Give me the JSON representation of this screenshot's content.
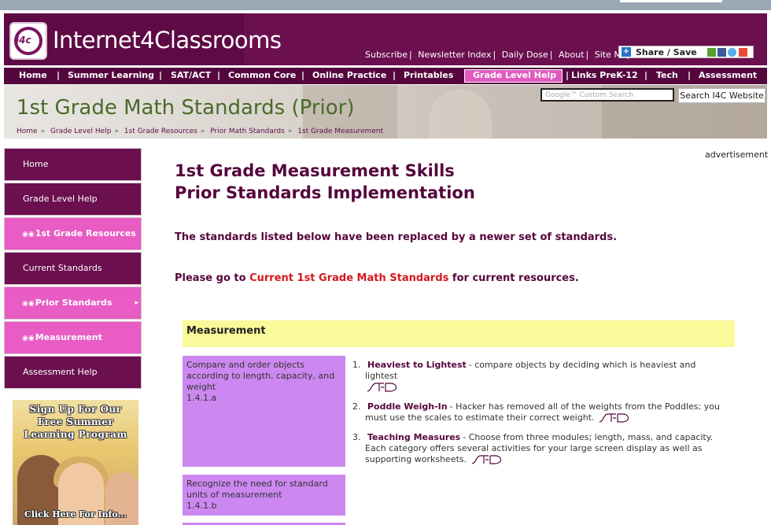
{
  "site": {
    "name": "Internet4Classrooms",
    "logo_text": "i4c"
  },
  "top_links": [
    "Subscribe",
    "Newsletter Index",
    "Daily Dose",
    "About",
    "Site Map"
  ],
  "share_label": "Share / Save",
  "nav": [
    "Home",
    "Summer Learning",
    "SAT/ACT",
    "Common Core",
    "Online Practice",
    "Printables",
    "Grade Level Help",
    "Links PreK-12",
    "Tech",
    "Assessment"
  ],
  "hero": {
    "title": "1st Grade Math Standards (Prior)",
    "search_placeholder": "Google™ Custom Search",
    "search_button": "Search I4C Website",
    "breadcrumb": [
      "Home",
      "Grade Level Help",
      "1st Grade Resources",
      "Prior Math Standards",
      "1st Grade Measurement"
    ]
  },
  "sidebar": {
    "items": [
      {
        "label": "Home",
        "style": "dark"
      },
      {
        "label": "Grade Level Help",
        "style": "dark"
      },
      {
        "label": "1st Grade Resources",
        "style": "pink"
      },
      {
        "label": "Current Standards",
        "style": "dark"
      },
      {
        "label": "Prior Standards",
        "style": "pink"
      },
      {
        "label": "Measurement",
        "style": "pink"
      },
      {
        "label": "Assessment Help",
        "style": "dark"
      }
    ],
    "promo_text": "Sign Up For Our Free Summer Learning Program",
    "promo_cta": "Click Here For Info..."
  },
  "ad_label": "advertisement",
  "main": {
    "heading_line1": "1st Grade Measurement Skills",
    "heading_line2": "Prior Standards Implementation",
    "notice1": "The standards listed below have been replaced by a newer set of standards.",
    "notice2_prefix": "Please go to",
    "notice2_link": "Current 1st Grade Math Standards",
    "notice2_suffix": "for current resources.",
    "section": "Measurement",
    "standards": [
      {
        "text": "Compare and order objects according to length, capacity, and weight",
        "code": "1.4.1.a"
      },
      {
        "text": "Recognize the need for standard units of measurement",
        "code": "1.4.1.b"
      }
    ],
    "resources": [
      {
        "num": "1.",
        "title": "Heaviest to Lightest",
        "desc": "- compare objects by deciding which is heaviest and lightest"
      },
      {
        "num": "2.",
        "title": "Poddle Weigh-In",
        "desc": "- Hacker has removed all of the weights from the Poddles; you must use the scales to estimate their correct weight."
      },
      {
        "num": "3.",
        "title": "Teaching Measures",
        "desc": "- Choose from three modules; length, mass, and capacity. Each category offers several activities for your large screen display as well as supporting worksheets."
      }
    ]
  },
  "colors": {
    "brand": "#6b0f4f",
    "accent_pink": "#e85cc4",
    "link_red": "#d4181e",
    "section_yellow": "#fafa9a",
    "cell_purple": "#cc88f0"
  }
}
